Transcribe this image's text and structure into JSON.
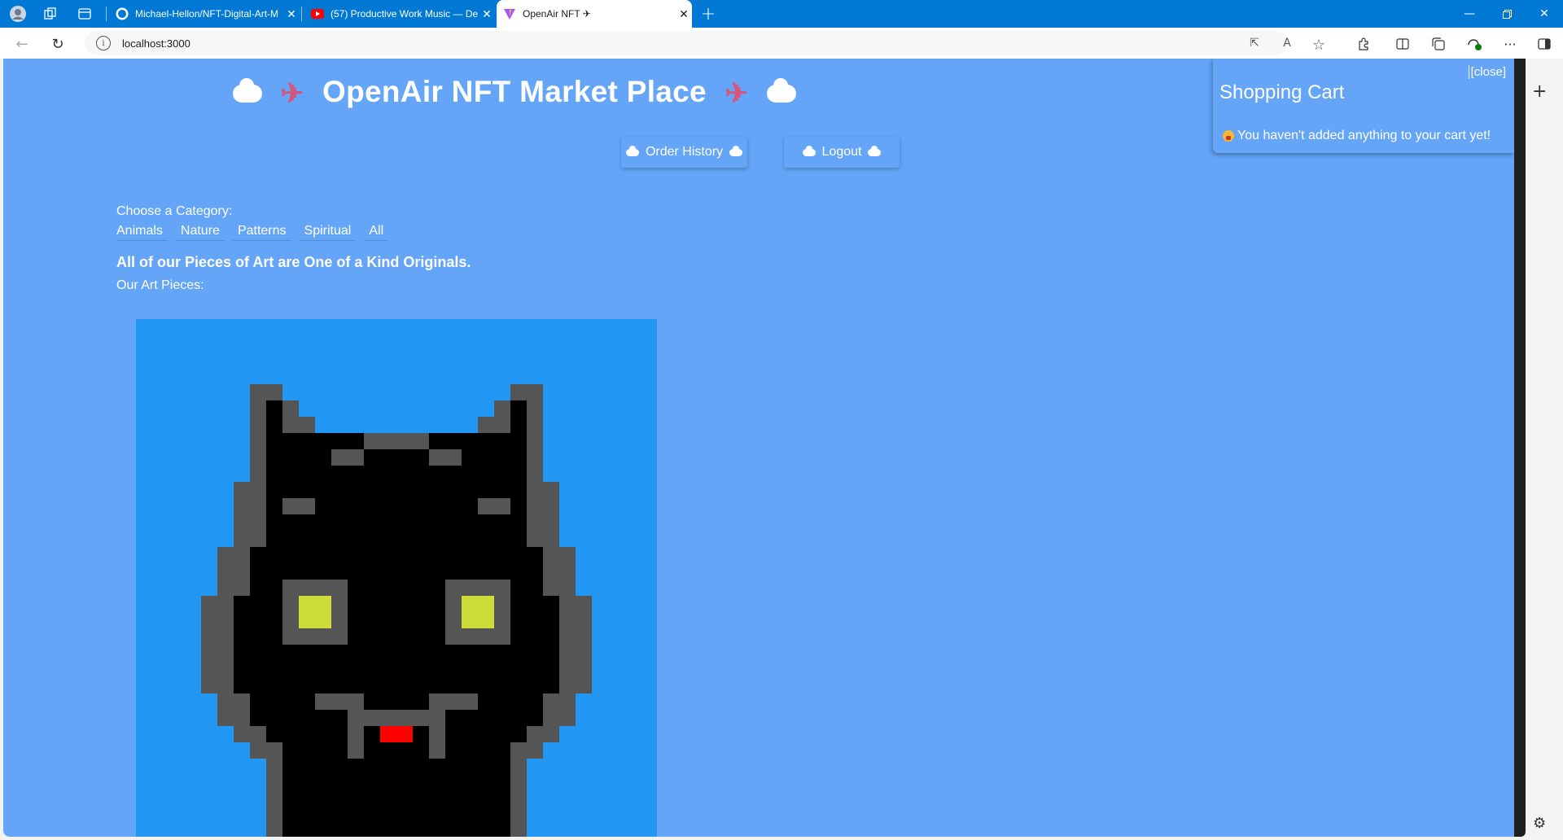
{
  "browser": {
    "tabs": [
      {
        "title": "Michael-Hellon/NFT-Digital-Art-M",
        "favicon": "github-icon"
      },
      {
        "title": "(57) Productive Work Music — De",
        "favicon": "youtube-icon"
      },
      {
        "title": "OpenAir NFT ✈",
        "favicon": "vite-icon",
        "active": true
      }
    ],
    "url": "localhost:3000"
  },
  "page": {
    "title": "OpenAir NFT Market Place",
    "buttons": {
      "order_history": "Order History",
      "logout": "Logout"
    },
    "category_label": "Choose a Category:",
    "categories": [
      "Animals",
      "Nature",
      "Patterns",
      "Spiritual",
      "All"
    ],
    "tagline": "All of our Pieces of Art are One of a Kind Originals.",
    "art_label": "Our Art Pieces:"
  },
  "cart": {
    "close": "[close]",
    "title": "Shopping Cart",
    "empty_message": "You haven't added anything to your cart yet!"
  },
  "colors": {
    "page_bg": "#64a5f8",
    "art_bg": "#2196f3",
    "accent_tab": "#0078d4"
  }
}
